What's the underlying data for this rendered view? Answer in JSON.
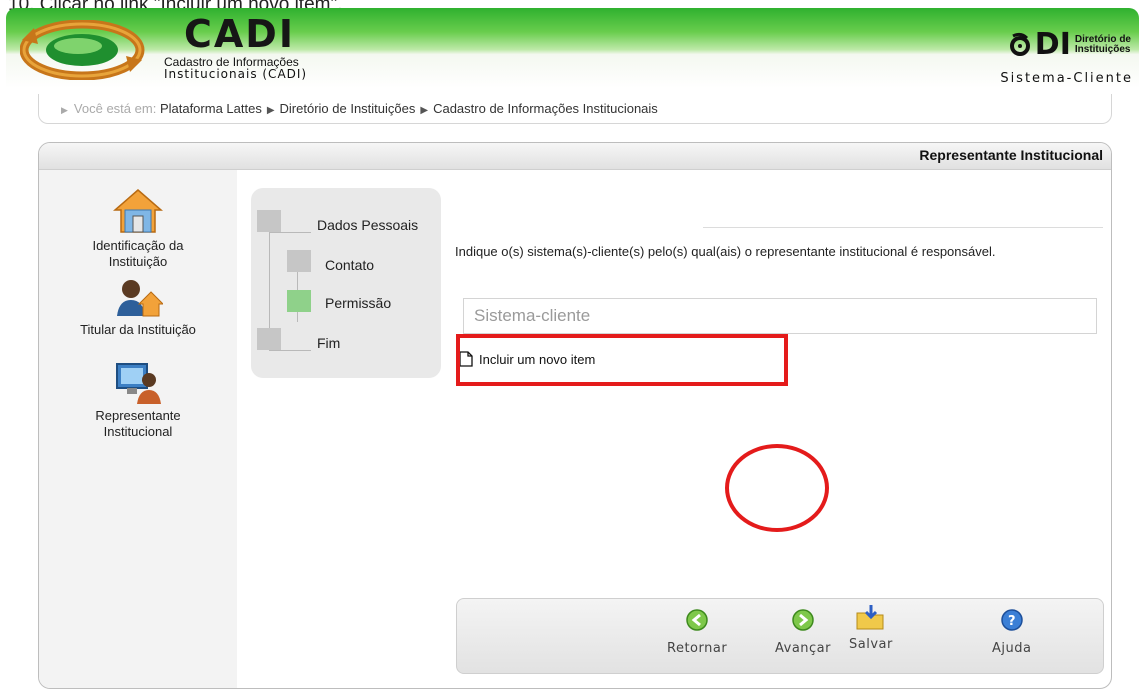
{
  "caption": "10. Clicar no link \"Incluir um novo item\".",
  "header": {
    "logo_title": "CADI",
    "logo_sub_line1": "Cadastro de Informações",
    "logo_sub_line2": "Institucionais (CADI)",
    "di_mark": "DI",
    "di_text_line1": "Diretório de",
    "di_text_line2": "Instituições",
    "system_label": "Sistema-Cliente"
  },
  "breadcrumb": {
    "prefix": "Você está em:",
    "items": [
      "Plataforma Lattes",
      "Diretório de Instituições",
      "Cadastro de Informações Institucionais"
    ]
  },
  "panel": {
    "title": "Representante Institucional"
  },
  "sidebar": {
    "items": [
      {
        "label_line1": "Identificação da",
        "label_line2": "Instituição",
        "icon": "house-icon"
      },
      {
        "label_line1": "Titular da Instituição",
        "label_line2": "",
        "icon": "person-house-icon"
      },
      {
        "label_line1": "Representante",
        "label_line2": "Institucional",
        "icon": "computer-person-icon"
      }
    ]
  },
  "steps": [
    {
      "label": "Dados Pessoais",
      "active": false
    },
    {
      "label": "Contato",
      "active": false
    },
    {
      "label": "Permissão",
      "active": true
    },
    {
      "label": "Fim",
      "active": false
    }
  ],
  "main": {
    "instruction": "Indique o(s) sistema(s)-cliente(s) pelo(s) qual(ais) o representante institucional é responsável.",
    "field_placeholder": "Sistema-cliente",
    "include_link": "Incluir um novo item"
  },
  "buttons": {
    "back": "Retornar",
    "next": "Avançar",
    "save": "Salvar",
    "help": "Ajuda"
  },
  "colors": {
    "highlight": "#e41b1b",
    "active_step": "#8fd18a",
    "header_green": "#2fb12f"
  }
}
